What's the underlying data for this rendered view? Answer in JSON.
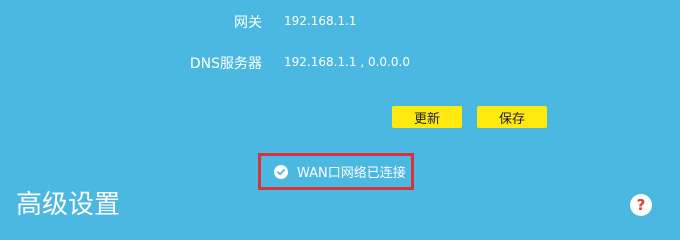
{
  "settings": {
    "gateway_label": "网关",
    "gateway_value": "192.168.1.1",
    "dns_label": "DNS服务器",
    "dns_value": "192.168.1.1 , 0.0.0.0"
  },
  "buttons": {
    "refresh_label": "更新",
    "save_label": "保存"
  },
  "status": {
    "text": "WAN口网络已连接",
    "icon": "check-circle-icon"
  },
  "section": {
    "title": "高级设置"
  },
  "help": {
    "glyph": "?",
    "icon": "help-icon"
  },
  "colors": {
    "background": "#4ab8e0",
    "button": "#ffe90f",
    "highlight_border": "#d6333b",
    "help_glyph": "#e03a2e"
  }
}
